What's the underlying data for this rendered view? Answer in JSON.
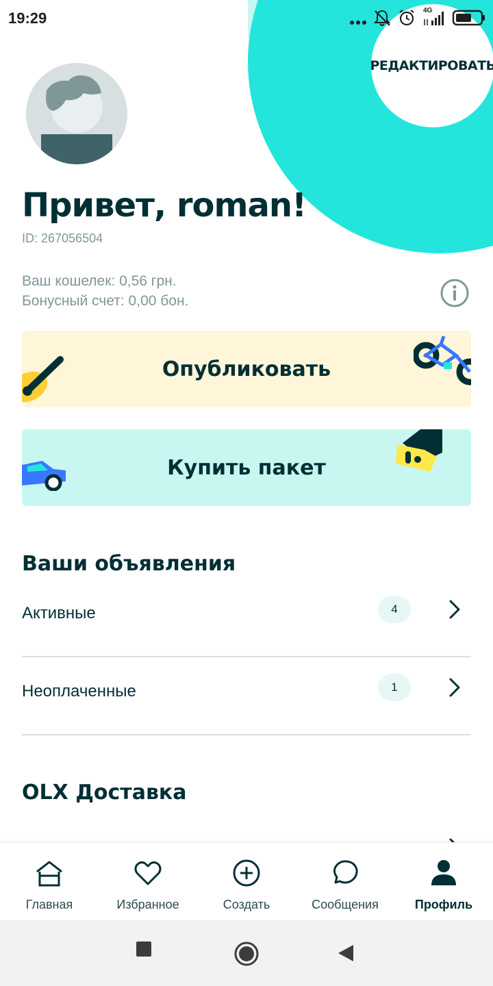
{
  "status_bar": {
    "time": "19:29",
    "network": "4G",
    "icons": [
      "more-dots-icon",
      "muted-bell-icon",
      "alarm-icon",
      "signal-icon",
      "battery-icon"
    ]
  },
  "profile": {
    "edit_label": "РЕДАКТИРОВАТЬ",
    "greeting": "Привет, roman!",
    "id_text": "ID: 267056504",
    "wallet_text": "Ваш кошелек: 0,56 грн.",
    "bonus_text": "Бонусный счет: 0,00 бон."
  },
  "actions": {
    "publish_label": "Опубликовать",
    "package_label": "Купить пакет"
  },
  "ads_section": {
    "title": "Ваши объявления",
    "rows": [
      {
        "label": "Активные",
        "count": "4"
      },
      {
        "label": "Неоплаченные",
        "count": "1"
      }
    ]
  },
  "delivery_section": {
    "title": "OLX Доставка"
  },
  "bottom_nav": {
    "items": [
      {
        "label": "Главная",
        "icon": "home-icon"
      },
      {
        "label": "Избранное",
        "icon": "heart-icon"
      },
      {
        "label": "Создать",
        "icon": "plus-circle-icon"
      },
      {
        "label": "Сообщения",
        "icon": "chat-icon"
      },
      {
        "label": "Профиль",
        "icon": "person-icon",
        "active": true
      }
    ]
  },
  "colors": {
    "primary_text": "#002f34",
    "teal": "#23e5db",
    "teal_light": "#c8f7f2",
    "yellow_light": "#fff6d9",
    "muted_text": "#7f9799"
  }
}
